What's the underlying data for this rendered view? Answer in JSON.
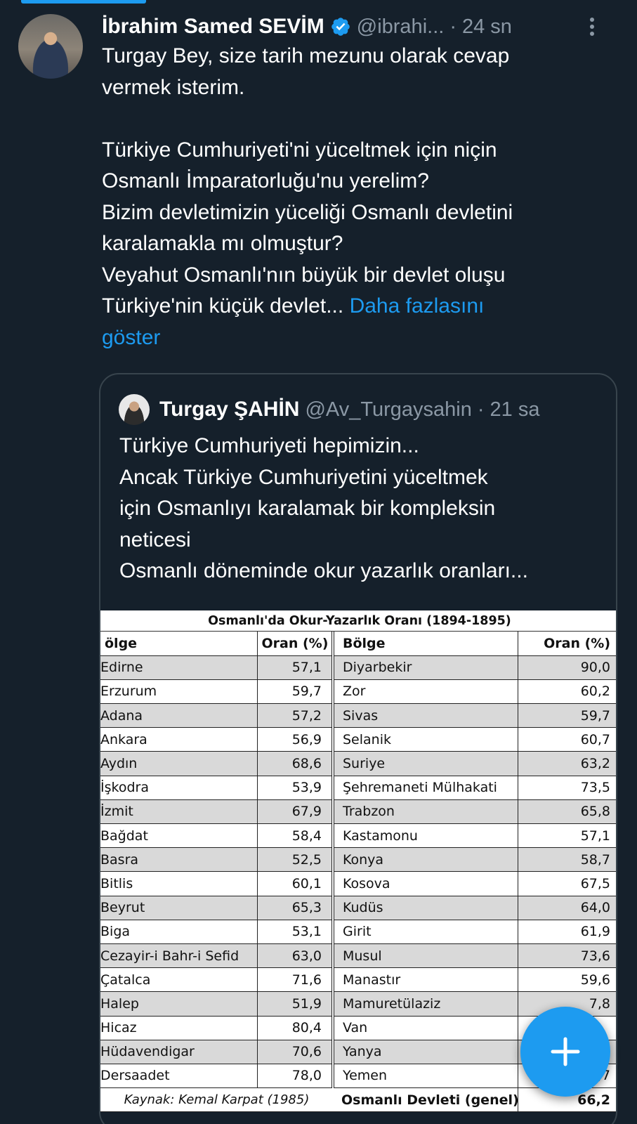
{
  "tweet": {
    "author_name": "İbrahim Samed SEVİM",
    "author_handle": "@ibrahi...",
    "separator": "·",
    "time": "24 sn",
    "body": [
      "Turgay Bey, size tarih mezunu olarak cevap",
      "vermek isterim.",
      "",
      "Türkiye Cumhuriyeti'ni yüceltmek için niçin",
      "Osmanlı İmparatorluğu'nu yerelim?",
      "Bizim devletimizin yüceliği Osmanlı devletini",
      "karalamakla mı olmuştur?",
      "Veyahut Osmanlı'nın büyük bir devlet oluşu",
      "Türkiye'nin küçük devlet..."
    ],
    "show_more_line1": "Daha fazlasını",
    "show_more_line2": "göster"
  },
  "quote": {
    "author_name": "Turgay ŞAHİN",
    "author_handle": "@Av_Turgaysahin",
    "separator": "·",
    "time": "21 sa",
    "body": [
      "Türkiye Cumhuriyeti hepimizin...",
      "Ancak Türkiye Cumhuriyetini yüceltmek",
      "için Osmanlıyı karalamak bir kompleksin",
      "neticesi",
      "Osmanlı döneminde okur yazarlık oranları..."
    ]
  },
  "table": {
    "title": "Osmanlı'da Okur-Yazarlık Oranı (1894-1895)",
    "headers": [
      "ölge",
      "Oran (%)",
      "Bölge",
      "Oran (%)"
    ],
    "rows": [
      [
        "Edirne",
        "57,1",
        "Diyarbekir",
        "90,0"
      ],
      [
        "Erzurum",
        "59,7",
        "Zor",
        "60,2"
      ],
      [
        "Adana",
        "57,2",
        "Sivas",
        "59,7"
      ],
      [
        "Ankara",
        "56,9",
        "Selanik",
        "60,7"
      ],
      [
        "Aydın",
        "68,6",
        "Suriye",
        "63,2"
      ],
      [
        "İşkodra",
        "53,9",
        "Şehremaneti Mülhakati",
        "73,5"
      ],
      [
        "İzmit",
        "67,9",
        "Trabzon",
        "65,8"
      ],
      [
        "Bağdat",
        "58,4",
        "Kastamonu",
        "57,1"
      ],
      [
        "Basra",
        "52,5",
        "Konya",
        "58,7"
      ],
      [
        "Bitlis",
        "60,1",
        "Kosova",
        "67,5"
      ],
      [
        "Beyrut",
        "65,3",
        "Kudüs",
        "64,0"
      ],
      [
        "Biga",
        "53,1",
        "Girit",
        "61,9"
      ],
      [
        "Cezayir-i Bahr-i Sefid",
        "63,0",
        "Musul",
        "73,6"
      ],
      [
        "Çatalca",
        "71,6",
        "Manastır",
        "59,6"
      ],
      [
        "Halep",
        "51,9",
        "Mamuretülaziz",
        "7,8"
      ],
      [
        "Hicaz",
        "80,4",
        "Van",
        ""
      ],
      [
        "Hüdavendigar",
        "70,6",
        "Yanya",
        ""
      ],
      [
        "Dersaadet",
        "78,0",
        "Yemen",
        ",7"
      ]
    ],
    "source": "Kaynak: Kemal Karpat (1985)",
    "total_label": "Osmanlı Devleti (genel)",
    "total_value": "66,2"
  },
  "colors": {
    "background": "#15202b",
    "accent": "#1d9bf0",
    "muted": "#8b98a5",
    "border": "#38444d"
  },
  "icons": {
    "verified": "verified-badge-icon",
    "more": "more-vertical-icon",
    "compose": "plus-icon"
  }
}
